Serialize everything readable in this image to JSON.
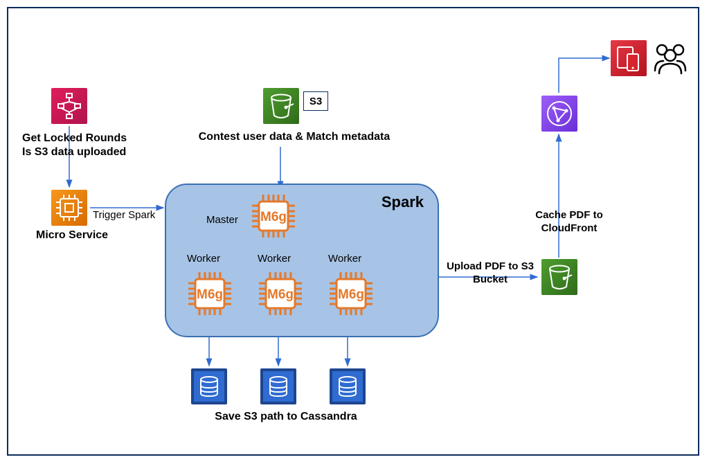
{
  "diagram": {
    "step_functions_caption_line1": "Get Locked Rounds",
    "step_functions_caption_line2": "Is S3 data uploaded",
    "micro_service_label": "Micro Service",
    "trigger_spark_label": "Trigger Spark",
    "s3_badge": "S3",
    "s3_caption": "Contest user data & Match metadata",
    "spark_title": "Spark",
    "master_label": "Master",
    "worker_label_1": "Worker",
    "worker_label_2": "Worker",
    "worker_label_3": "Worker",
    "chip_text": "M6g",
    "upload_label": "Upload PDF to S3 Bucket",
    "cache_label": "Cache PDF to CloudFront",
    "cassandra_caption": "Save S3 path to Cassandra",
    "colors": {
      "pink": "#d43169",
      "orange": "#ec7211",
      "green": "#3f8624",
      "purple": "#8c4fff",
      "red": "#d6242d",
      "blue_db": "#2f6bd1",
      "arrow": "#2f6bd1",
      "spark_bg": "#a7c4e6",
      "chip_stroke": "#e4792b"
    }
  }
}
